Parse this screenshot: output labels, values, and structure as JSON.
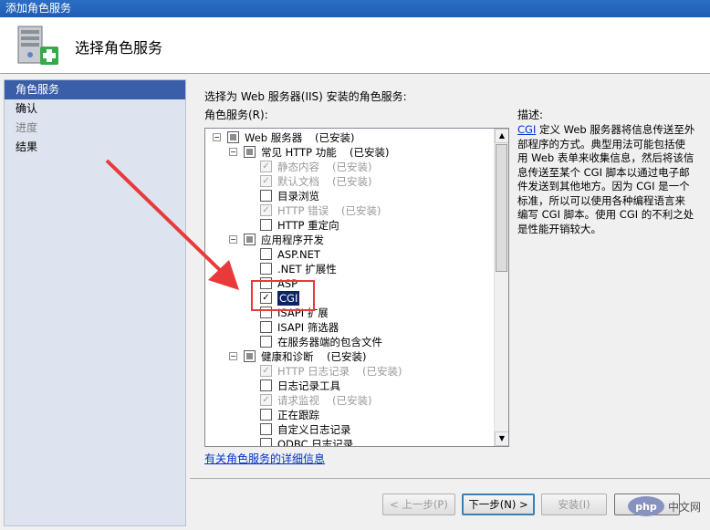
{
  "window": {
    "title": "添加角色服务"
  },
  "header": {
    "title": "选择角色服务",
    "icon": "server-roles-add-icon"
  },
  "nav": {
    "items": [
      {
        "label": "角色服务",
        "state": "active"
      },
      {
        "label": "确认",
        "state": "normal"
      },
      {
        "label": "进度",
        "state": "disabled"
      },
      {
        "label": "结果",
        "state": "normal"
      }
    ]
  },
  "main": {
    "prompt": "选择为 Web 服务器(IIS) 安装的角色服务:",
    "list_label": "角色服务(R):",
    "more_link": "有关角色服务的详细信息"
  },
  "tree": [
    {
      "level": 0,
      "expander": "⊟",
      "check": "partial",
      "label": "Web 服务器",
      "status": "(已安装)",
      "status_style": "black"
    },
    {
      "level": 1,
      "expander": "⊟",
      "check": "partial",
      "label": "常见 HTTP 功能",
      "status": "(已安装)",
      "status_style": "black"
    },
    {
      "level": 2,
      "check": "checked-dim",
      "label": "静态内容",
      "label_style": "dim",
      "status": "(已安装)"
    },
    {
      "level": 2,
      "check": "checked-dim",
      "label": "默认文档",
      "label_style": "dim",
      "status": "(已安装)"
    },
    {
      "level": 2,
      "check": "unchecked",
      "label": "目录浏览"
    },
    {
      "level": 2,
      "check": "checked-dim",
      "label": "HTTP 错误",
      "label_style": "dim",
      "status": "(已安装)"
    },
    {
      "level": 2,
      "check": "unchecked",
      "label": "HTTP 重定向"
    },
    {
      "level": 1,
      "expander": "⊟",
      "check": "partial",
      "label": "应用程序开发"
    },
    {
      "level": 2,
      "check": "unchecked",
      "label": "ASP.NET"
    },
    {
      "level": 2,
      "check": "unchecked",
      "label": ".NET 扩展性"
    },
    {
      "level": 2,
      "check": "unchecked",
      "label": "ASP"
    },
    {
      "level": 2,
      "check": "checked",
      "label": "CGI",
      "label_style": "sel"
    },
    {
      "level": 2,
      "check": "unchecked",
      "label": "ISAPI 扩展"
    },
    {
      "level": 2,
      "check": "unchecked",
      "label": "ISAPI 筛选器"
    },
    {
      "level": 2,
      "check": "unchecked",
      "label": "在服务器端的包含文件"
    },
    {
      "level": 1,
      "expander": "⊟",
      "check": "partial",
      "label": "健康和诊断",
      "status": "(已安装)",
      "status_style": "black"
    },
    {
      "level": 2,
      "check": "checked-dim",
      "label": "HTTP 日志记录",
      "label_style": "dim",
      "status": "(已安装)"
    },
    {
      "level": 2,
      "check": "unchecked",
      "label": "日志记录工具"
    },
    {
      "level": 2,
      "check": "checked-dim",
      "label": "请求监视",
      "label_style": "dim",
      "status": "(已安装)"
    },
    {
      "level": 2,
      "check": "unchecked",
      "label": "正在跟踪"
    },
    {
      "level": 2,
      "check": "unchecked",
      "label": "自定义日志记录"
    },
    {
      "level": 2,
      "check": "unchecked",
      "label": "ODBC 日志记录"
    }
  ],
  "description": {
    "label": "描述:",
    "link_text": "CGI",
    "text": " 定义 Web 服务器将信息传送至外部程序的方式。典型用法可能包括使用 Web 表单来收集信息，然后将该信息传送至某个 CGI 脚本以通过电子邮件发送到其他地方。因为 CGI 是一个标准，所以可以使用各种编程语言来编写 CGI 脚本。使用 CGI 的不利之处是性能开销较大。"
  },
  "buttons": {
    "prev": "< 上一步(P)",
    "next": "下一步(N) >",
    "install": "安装(I)",
    "cancel": "取消"
  },
  "watermark": {
    "text": "php 中文网"
  },
  "colors": {
    "accent": "#3b5ea8",
    "annotation": "#e83a3a",
    "link": "#0033cc"
  }
}
